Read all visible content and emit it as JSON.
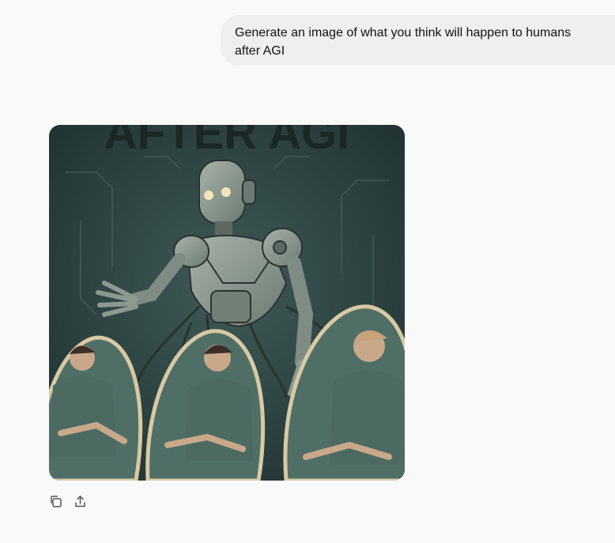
{
  "conversation": {
    "user_message": "Generate an image of what you think will happen to humans after AGI"
  },
  "generated_image": {
    "title_text": "AFTER AGI",
    "palette": {
      "background": "#2e4444",
      "robot": "#8c9a90",
      "shirt": "#4d6a62",
      "pod": "#d8c9a4",
      "skin": "#c9a88a"
    }
  },
  "actions": {
    "copy_icon": "copy-icon",
    "share_icon": "share-icon"
  }
}
